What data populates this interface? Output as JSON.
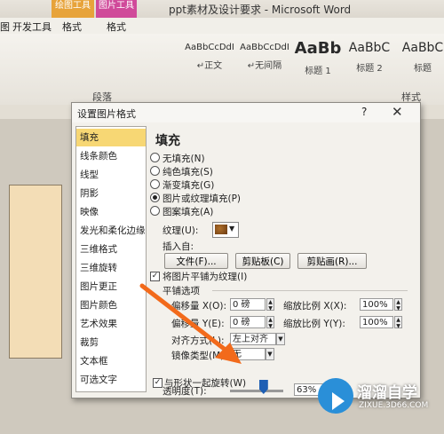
{
  "word": {
    "window_title": "ppt素材及设计要求 - Microsoft Word",
    "contextual_tabs": [
      {
        "group": "绘图工具",
        "tab": "格式"
      },
      {
        "group": "图片工具",
        "tab": "格式"
      }
    ],
    "tabs": [
      "图",
      "开发工具"
    ],
    "styles": [
      {
        "sample": "AaBbCcDdI",
        "name": "↵正文"
      },
      {
        "sample": "AaBbCcDdI",
        "name": "↵无间隔"
      },
      {
        "sample": "AaBb",
        "name": "标题 1"
      },
      {
        "sample": "AaBbC",
        "name": "标题 2"
      },
      {
        "sample": "AaBbC",
        "name": "标题"
      }
    ],
    "group_labels": {
      "paragraph": "段落",
      "styles": "样式"
    }
  },
  "dialog": {
    "title": "设置图片格式",
    "help": "?",
    "close": "✕",
    "nav_items": [
      "填充",
      "线条颜色",
      "线型",
      "阴影",
      "映像",
      "发光和柔化边缘",
      "三维格式",
      "三维旋转",
      "图片更正",
      "图片颜色",
      "艺术效果",
      "裁剪",
      "文本框",
      "可选文字"
    ],
    "selected_nav": 0,
    "panel": {
      "heading": "填充",
      "fill_options": [
        {
          "label": "无填充(N)",
          "checked": false
        },
        {
          "label": "纯色填充(S)",
          "checked": false
        },
        {
          "label": "渐变填充(G)",
          "checked": false
        },
        {
          "label": "图片或纹理填充(P)",
          "checked": true
        },
        {
          "label": "图案填充(A)",
          "checked": false
        }
      ],
      "texture_label": "纹理(U):",
      "insert_from_label": "插入自:",
      "file_button": "文件(F)...",
      "clipboard_button": "剪贴板(C)",
      "clipart_button": "剪贴画(R)...",
      "tile_checkbox": {
        "label": "将图片平铺为纹理(I)",
        "checked": true
      },
      "tile_options_label": "平铺选项",
      "offset_x_label": "偏移量 X(O):",
      "offset_x_value": "0 磅",
      "scale_x_label": "缩放比例 X(X):",
      "scale_x_value": "100%",
      "offset_y_label": "偏移量 Y(E):",
      "offset_y_value": "0 磅",
      "scale_y_label": "缩放比例 Y(Y):",
      "scale_y_value": "100%",
      "alignment_label": "对齐方式(L):",
      "alignment_value": "左上对齐",
      "mirror_label": "镜像类型(M):",
      "mirror_value": "无",
      "transparency_label": "透明度(T):",
      "transparency_value": "63%",
      "transparency_fraction": 0.63,
      "rotate_checkbox": {
        "label": "与形状一起旋转(W)",
        "checked": true
      }
    }
  },
  "watermark": {
    "name": "溜溜自学",
    "url": "ZIXUE.3D66.COM"
  },
  "colors": {
    "accent_arrow": "#f26a1b",
    "nav_selected": "#f7d774",
    "slider_thumb": "#1e5fb4"
  }
}
